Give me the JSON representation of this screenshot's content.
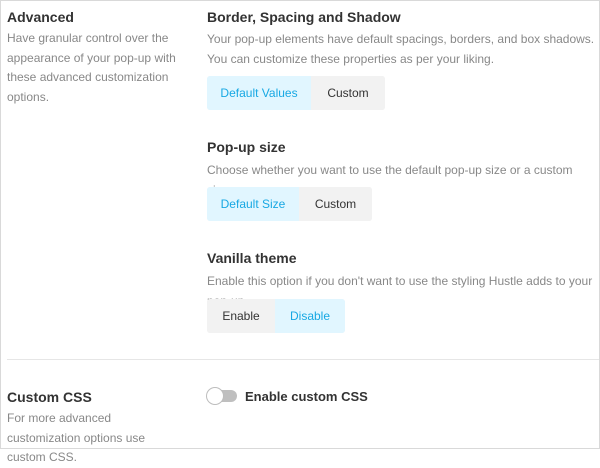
{
  "advanced": {
    "title": "Advanced",
    "description": "Have granular control over the appearance of your pop-up with these advanced customization options."
  },
  "border_spacing_shadow": {
    "title": "Border, Spacing and Shadow",
    "description": "Your pop-up elements have default spacings, borders, and box shadows. You can customize these properties as per your liking.",
    "options": [
      "Default Values",
      "Custom"
    ],
    "selected": "Default Values"
  },
  "popup_size": {
    "title": "Pop-up size",
    "description": "Choose whether you want to use the default pop-up size or a custom size.",
    "options": [
      "Default Size",
      "Custom"
    ],
    "selected": "Default Size"
  },
  "vanilla_theme": {
    "title": "Vanilla theme",
    "description": "Enable this option if you don't want to use the styling Hustle adds to your pop-up.",
    "options": [
      "Enable",
      "Disable"
    ],
    "selected": "Disable"
  },
  "custom_css": {
    "title": "Custom CSS",
    "description": "For more advanced customization options use custom CSS.",
    "toggle_label": "Enable custom CSS",
    "enabled": false
  },
  "colors": {
    "active_bg": "#e1f6ff",
    "active_text": "#17a8e3",
    "inactive_bg": "#f2f2f2",
    "toggle_off": "#bfbfbf"
  }
}
